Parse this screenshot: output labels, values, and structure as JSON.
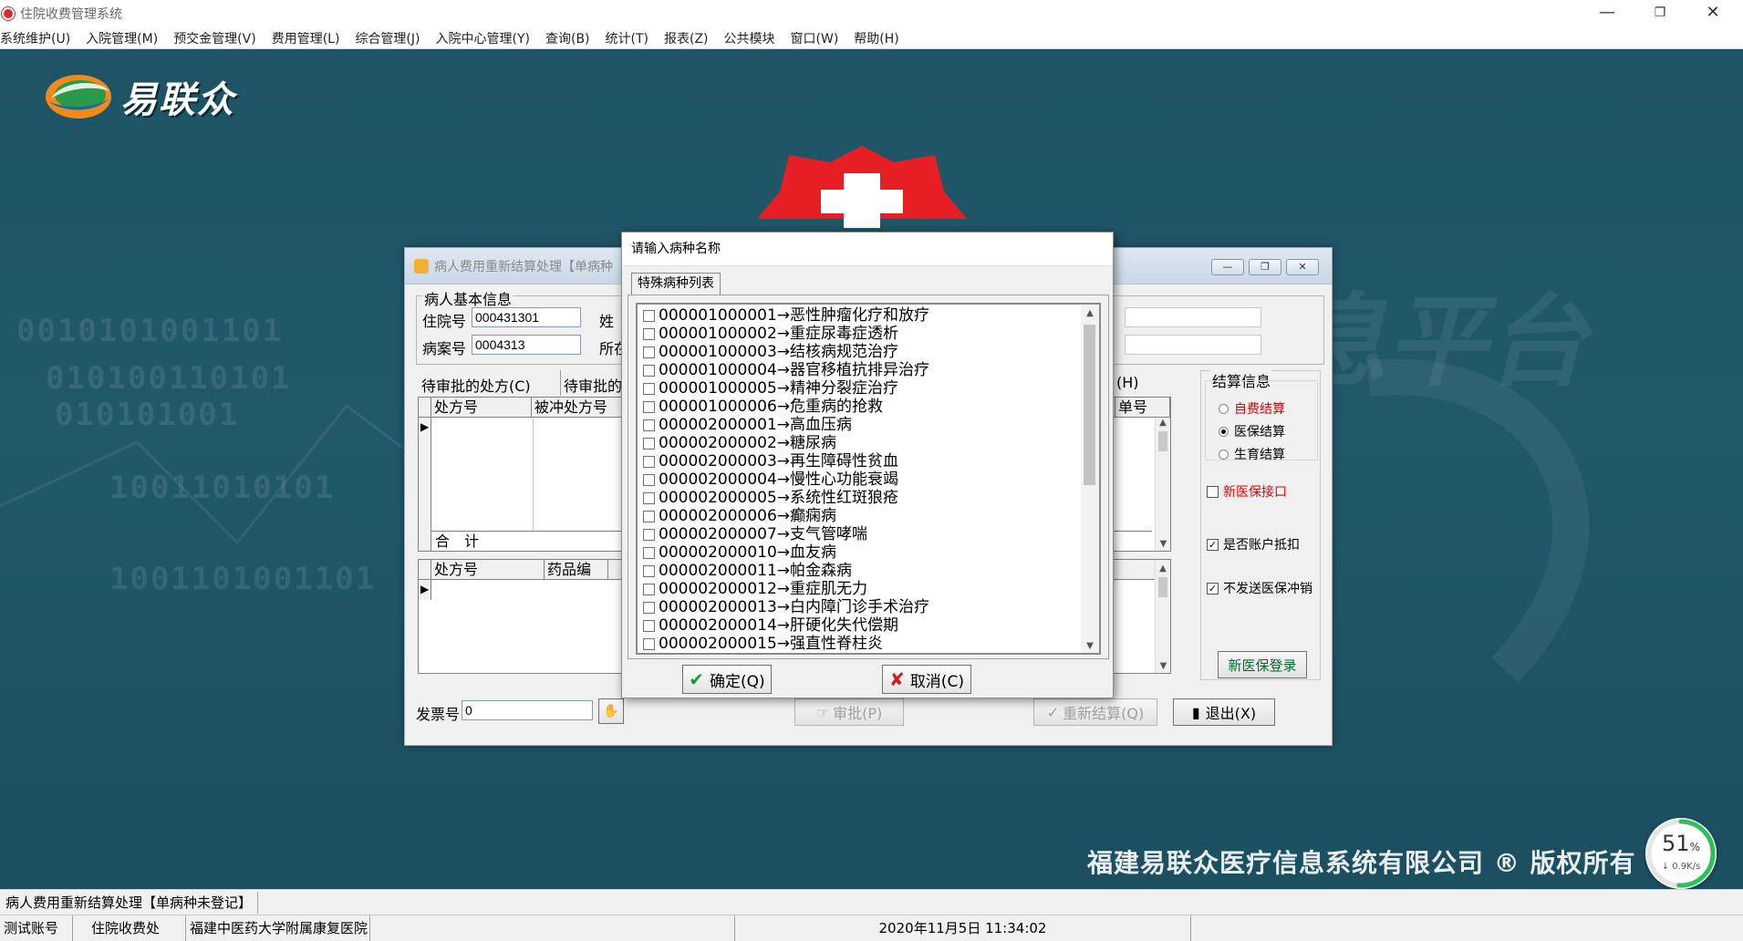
{
  "app": {
    "title": "住院收费管理系统",
    "window_controls": [
      "—",
      "❐",
      "✕"
    ]
  },
  "menu": [
    "系统维护(U)",
    "入院管理(M)",
    "预交金管理(V)",
    "费用管理(L)",
    "综合管理(J)",
    "入院中心管理(Y)",
    "查询(B)",
    "统计(T)",
    "报表(Z)",
    "公共模块",
    "窗口(W)",
    "帮助(H)"
  ],
  "desktop": {
    "logo_text": "易联众",
    "copyright": "福建易联众医疗信息系统有限公司 ® 版权所有",
    "progress": {
      "value": "51",
      "unit": "%",
      "speed": "0.9K/s"
    }
  },
  "bg_window": {
    "title": "病人费用重新结算处理【单病种",
    "min_label": "—",
    "max_label": "❐",
    "close_label": "✕",
    "basic_info_title": "病人基本信息",
    "inpatient_no_label": "住院号",
    "inpatient_no_value": "000431301",
    "case_no_label": "病案号",
    "case_no_value": "0004313",
    "name_label": "姓",
    "location_label": "所在",
    "tab_pending_rx": "待审批的处方(C)",
    "tab_pending_2": "待审批的",
    "tab_h": "(H)",
    "grid1_headers": [
      "处方号",
      "被冲处方号"
    ],
    "grid1_right_header": "单号",
    "grid1_total": "合　计",
    "grid2_headers": [
      "处方号",
      "药品编"
    ],
    "invoice_label": "发票号",
    "invoice_value": "0",
    "settle_group_title": "结算信息",
    "settle_options": [
      {
        "label": "自费结算",
        "selected": false,
        "color": "#e00000"
      },
      {
        "label": "医保结算",
        "selected": true,
        "color": "#000000"
      },
      {
        "label": "生育结算",
        "selected": false,
        "color": "#000000"
      }
    ],
    "new_insurance_interface": "新医保接口",
    "account_deduct": "是否账户抵扣",
    "no_send_reversal": "不发送医保冲销",
    "new_insurance_login": "新医保登录",
    "approve_btn": "审批(P)",
    "resettle_btn": "重新结算(Q)",
    "exit_btn": "退出(X)"
  },
  "dialog": {
    "title": "请输入病种名称",
    "tab": "特殊病种列表",
    "items": [
      "000001000001→恶性肿瘤化疗和放疗",
      "000001000002→重症尿毒症透析",
      "000001000003→结核病规范治疗",
      "000001000004→器官移植抗排异治疗",
      "000001000005→精神分裂症治疗",
      "000001000006→危重病的抢救",
      "000002000001→高血压病",
      "000002000002→糖尿病",
      "000002000003→再生障碍性贫血",
      "000002000004→慢性心功能衰竭",
      "000002000005→系统性红斑狼疮",
      "000002000006→癫痫病",
      "000002000007→支气管哮喘",
      "000002000010→血友病",
      "000002000011→帕金森病",
      "000002000012→重症肌无力",
      "000002000013→白内障门诊手术治疗",
      "000002000014→肝硬化失代偿期",
      "000002000015→强直性脊柱炎"
    ],
    "ok_label": "确定(Q)",
    "cancel_label": "取消(C)"
  },
  "status": {
    "task": "病人费用重新结算处理【单病种未登记】",
    "account": "测试账号",
    "department": "住院收费处",
    "hospital": "福建中医药大学附属康复医院",
    "datetime": "2020年11月5日 11:34:02"
  }
}
